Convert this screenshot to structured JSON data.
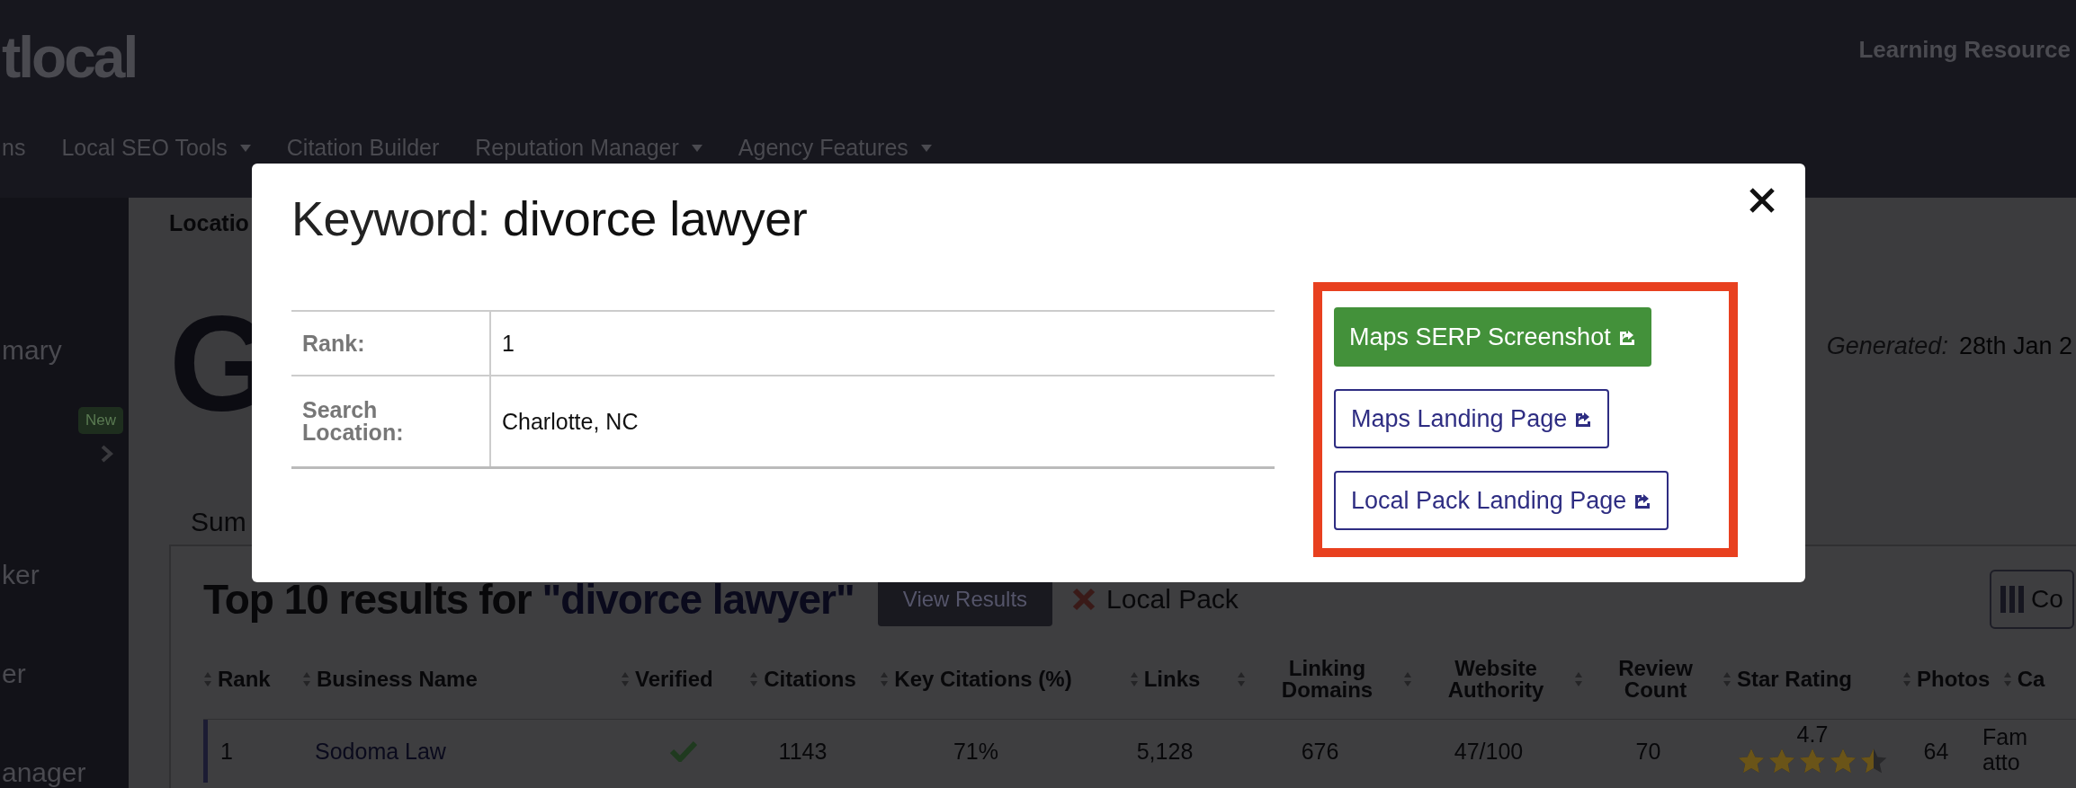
{
  "header": {
    "logo": "tlocal",
    "right_link": "Learning Resource",
    "nav": [
      {
        "label": "ns",
        "dropdown": false
      },
      {
        "label": "Local SEO Tools",
        "dropdown": true
      },
      {
        "label": "Citation Builder",
        "dropdown": false
      },
      {
        "label": "Reputation Manager",
        "dropdown": true
      },
      {
        "label": "Agency Features",
        "dropdown": true
      }
    ]
  },
  "sidebar": {
    "items": [
      {
        "kind": "link",
        "label": "mary"
      },
      {
        "kind": "expander",
        "badge": "New"
      },
      {
        "kind": "link",
        "label": "ker"
      },
      {
        "kind": "link",
        "label": "er"
      },
      {
        "kind": "link",
        "label": "anager"
      }
    ]
  },
  "breadcrumb": "Locatio",
  "report": {
    "logo_letter": "G",
    "generated_label": "Generated:",
    "generated_value": "28th Jan 2",
    "tab": "Sum"
  },
  "card": {
    "title": "Top 10 results for",
    "keyword": "\"divorce lawyer\"",
    "view_button": "View Results",
    "local_pack": "Local Pack",
    "columns_button": "Co"
  },
  "table": {
    "columns": [
      "Rank",
      "Business Name",
      "Verified",
      "Citations",
      "Key Citations (%)",
      "Links",
      "Linking Domains",
      "Website Authority",
      "Review Count",
      "Star Rating",
      "Photos",
      "Ca"
    ],
    "rows": [
      {
        "rank": "1",
        "business_name": "Sodoma Law",
        "verified": true,
        "citations": "1143",
        "key_citations": "71%",
        "links": "5,128",
        "linking_domains": "676",
        "website_authority": "47/100",
        "review_count": "70",
        "star_rating": "4.7",
        "stars": 4.5,
        "photos": "64",
        "column_12": "Fam atto"
      }
    ]
  },
  "modal": {
    "title_label": "Keyword:",
    "title_value": "divorce lawyer",
    "details": [
      {
        "label": "Rank:",
        "value": "1"
      },
      {
        "label": "Search Location:",
        "value": "Charlotte, NC"
      }
    ],
    "highlighted": true,
    "buttons": [
      {
        "kind": "primary",
        "label": "Maps SERP Screenshot"
      },
      {
        "kind": "outline",
        "label": "Maps Landing Page"
      },
      {
        "kind": "outline",
        "label": "Local Pack Landing Page"
      }
    ]
  }
}
